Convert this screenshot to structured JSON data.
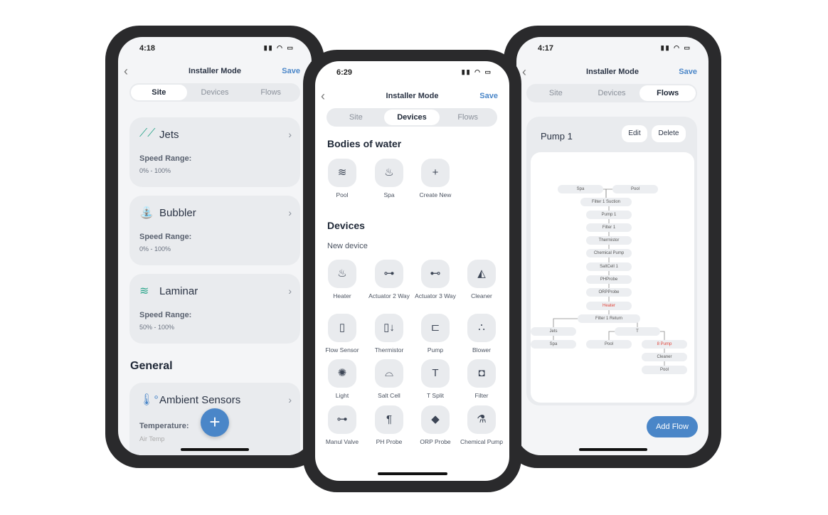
{
  "left": {
    "time": "4:18",
    "title": "Installer Mode",
    "save": "Save",
    "tabs": [
      "Site",
      "Devices",
      "Flows"
    ],
    "active_tab": 0,
    "cards": [
      {
        "name": "Jets",
        "label": "Speed Range:",
        "value": "0% - 100%",
        "icon": "jets-icon"
      },
      {
        "name": "Bubbler",
        "label": "Speed Range:",
        "value": "0% - 100%",
        "icon": "bubbler-icon"
      },
      {
        "name": "Laminar",
        "label": "Speed Range:",
        "value": "50% - 100%",
        "icon": "laminar-icon"
      }
    ],
    "general": "General",
    "ambient": {
      "name": "Ambient Sensors",
      "label": "Temperature:",
      "value": "Air Temp"
    },
    "fab": "+",
    "accent": "#4a86c8"
  },
  "middle": {
    "time": "6:29",
    "title": "Installer Mode",
    "save": "Save",
    "tabs": [
      "Site",
      "Devices",
      "Flows"
    ],
    "active_tab": 1,
    "bodies_title": "Bodies of water",
    "bodies": [
      {
        "label": "Pool",
        "icon": "≋"
      },
      {
        "label": "Spa",
        "icon": "♨"
      },
      {
        "label": "Create New",
        "icon": "+"
      }
    ],
    "devices_title": "Devices",
    "new_device": "New device",
    "devices": [
      {
        "label": "Heater",
        "icon": "♨"
      },
      {
        "label": "Actuator 2 Way",
        "icon": "⊶"
      },
      {
        "label": "Actuator 3 Way",
        "icon": "⊷"
      },
      {
        "label": "Cleaner",
        "icon": "◭"
      },
      {
        "label": "Flow Sensor",
        "icon": "▯"
      },
      {
        "label": "Thermistor",
        "icon": "▯↓"
      },
      {
        "label": "Pump",
        "icon": "⊏"
      },
      {
        "label": "Blower",
        "icon": "∴"
      },
      {
        "label": "Light",
        "icon": "✺"
      },
      {
        "label": "Salt Cell",
        "icon": "⌓"
      },
      {
        "label": "T Split",
        "icon": "T"
      },
      {
        "label": "Filter",
        "icon": "◘"
      },
      {
        "label": "Manul Valve",
        "icon": "⊶"
      },
      {
        "label": "PH Probe",
        "icon": "¶"
      },
      {
        "label": "ORP Probe",
        "icon": "◆"
      },
      {
        "label": "Chemical Pump",
        "icon": "⚗"
      }
    ]
  },
  "right": {
    "time": "4:17",
    "title": "Installer Mode",
    "save": "Save",
    "tabs": [
      "Site",
      "Devices",
      "Flows"
    ],
    "active_tab": 2,
    "flow_name": "Pump 1",
    "edit": "Edit",
    "delete": "Delete",
    "add_flow": "Add Flow",
    "nodes": [
      "Spa",
      "Pool",
      "Filter 1 Suction",
      "Pump 1",
      "Filter 1",
      "Thermistor",
      "Chemical Pump",
      "SaltCell 1",
      "PHProbe",
      "ORPProbe",
      "Heater",
      "Filter 1 Return",
      "Jets",
      "Spa",
      "T",
      "Pool",
      "8 Pump",
      "Cleaner",
      "Pool"
    ],
    "highlight_color": "#e0453a"
  }
}
